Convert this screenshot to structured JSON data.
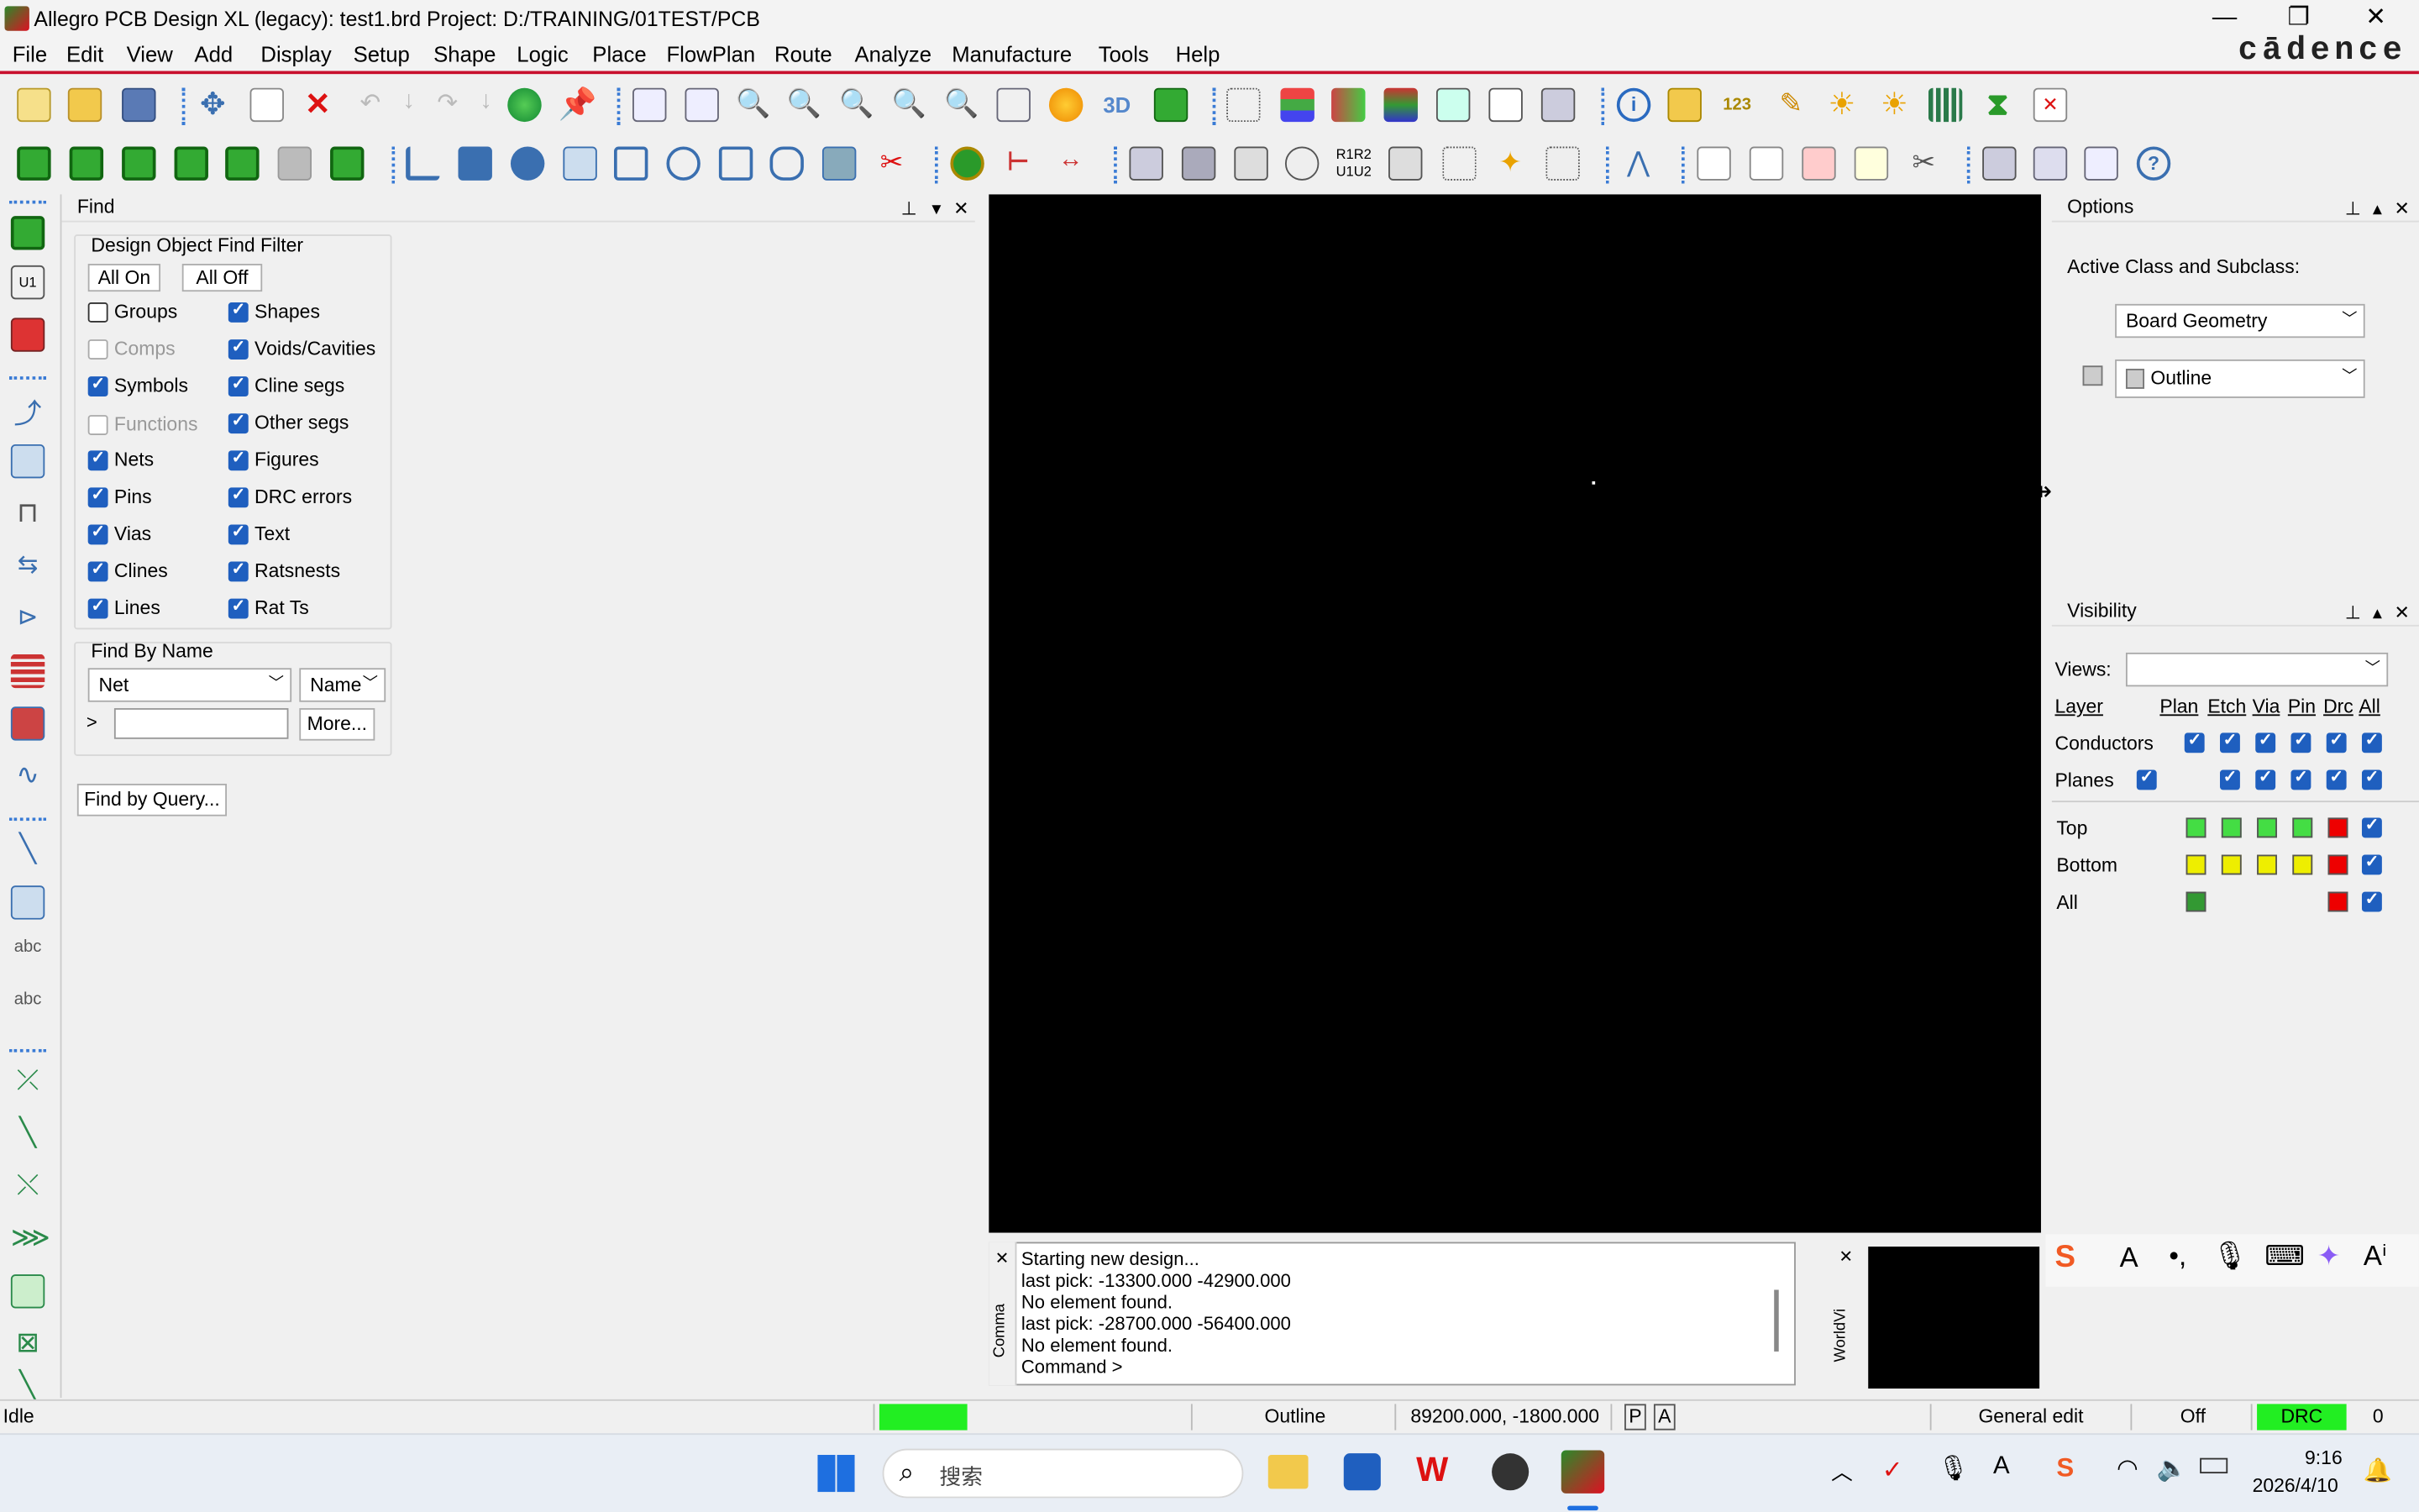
{
  "window": {
    "title": "Allegro PCB Design XL (legacy): test1.brd  Project: D:/TRAINING/01TEST/PCB",
    "brand": "cādence"
  },
  "menu": [
    "File",
    "Edit",
    "View",
    "Add",
    "Display",
    "Setup",
    "Shape",
    "Logic",
    "Place",
    "FlowPlan",
    "Route",
    "Analyze",
    "Manufacture",
    "Tools",
    "Help"
  ],
  "find": {
    "panel_title": "Find",
    "filter_title": "Design Object Find Filter",
    "all_on": "All On",
    "all_off": "All Off",
    "left_items": [
      {
        "label": "Groups",
        "checked": false,
        "enabled": true
      },
      {
        "label": "Comps",
        "checked": false,
        "enabled": false
      },
      {
        "label": "Symbols",
        "checked": true,
        "enabled": true
      },
      {
        "label": "Functions",
        "checked": false,
        "enabled": false
      },
      {
        "label": "Nets",
        "checked": true,
        "enabled": true
      },
      {
        "label": "Pins",
        "checked": true,
        "enabled": true
      },
      {
        "label": "Vias",
        "checked": true,
        "enabled": true
      },
      {
        "label": "Clines",
        "checked": true,
        "enabled": true
      },
      {
        "label": "Lines",
        "checked": true,
        "enabled": true
      }
    ],
    "right_items": [
      {
        "label": "Shapes",
        "checked": true
      },
      {
        "label": "Voids/Cavities",
        "checked": true
      },
      {
        "label": "Cline segs",
        "checked": true
      },
      {
        "label": "Other segs",
        "checked": true
      },
      {
        "label": "Figures",
        "checked": true
      },
      {
        "label": "DRC errors",
        "checked": true
      },
      {
        "label": "Text",
        "checked": true
      },
      {
        "label": "Ratsnests",
        "checked": true
      },
      {
        "label": "Rat Ts",
        "checked": true
      }
    ],
    "by_name_title": "Find By Name",
    "type_value": "Net",
    "mode_value": "Name",
    "prompt": ">",
    "name_value": "",
    "more": "More...",
    "query": "Find by Query..."
  },
  "command": {
    "lines": [
      "Starting new design...",
      "last pick:  -13300.000 -42900.000",
      "No element found.",
      "last pick:  -28700.000 -56400.000",
      "No element found.",
      "Command >"
    ],
    "side_label": "Comma",
    "world_label": "WorldVi"
  },
  "options": {
    "panel_title": "Options",
    "label": "Active Class and Subclass:",
    "class_value": "Board Geometry",
    "subclass_value": "Outline"
  },
  "visibility": {
    "panel_title": "Visibility",
    "views_label": "Views:",
    "views_value": "",
    "headers": [
      "Layer",
      "Plan",
      "Etch",
      "Via",
      "Pin",
      "Drc",
      "All"
    ],
    "rows": [
      "Conductors",
      "Planes",
      "Top",
      "Bottom",
      "All"
    ],
    "colors": {
      "top": "#44dd44",
      "bottom": "#eeee00",
      "drc": "#ee0000",
      "all": "#339933"
    }
  },
  "status": {
    "state": "Idle",
    "subclass": "Outline",
    "coords": "89200.000, -1800.000",
    "p": "P",
    "a": "A",
    "mode": "General edit",
    "off": "Off",
    "drc": "DRC",
    "count": "0"
  },
  "taskbar": {
    "search": "搜索",
    "time": "9:16",
    "date": "2026/4/10"
  }
}
